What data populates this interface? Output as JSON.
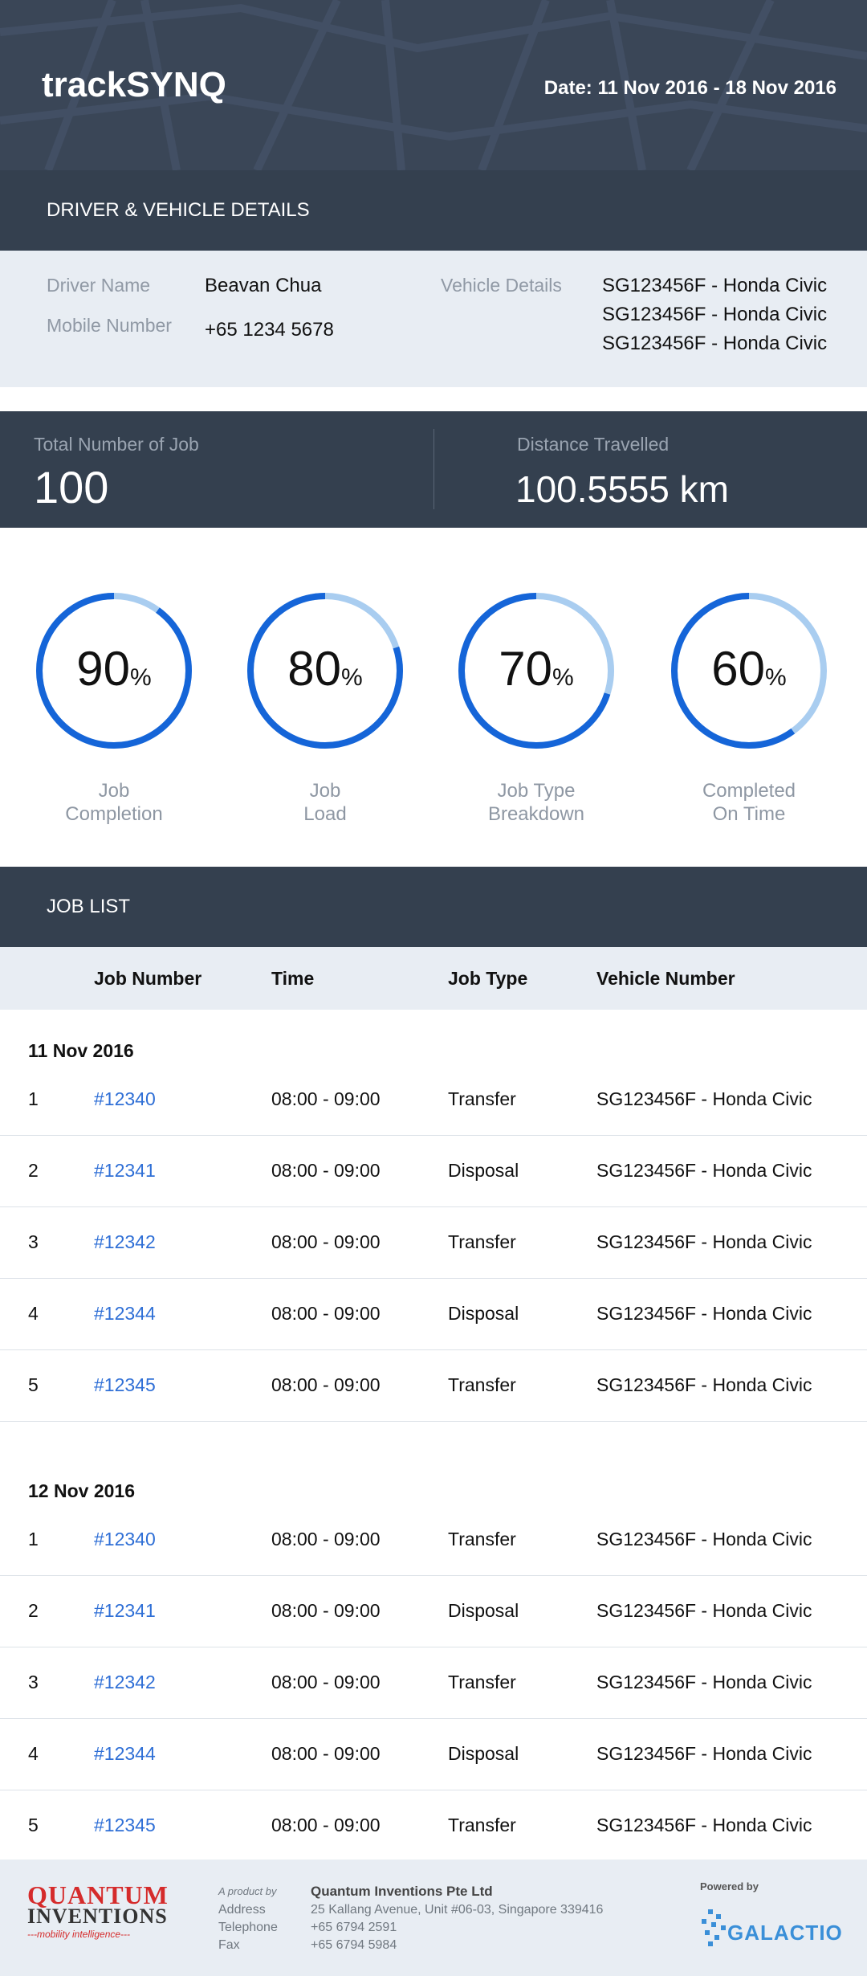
{
  "header": {
    "logo_text": "trackSYNQ",
    "date_label": "Date: 11 Nov 2016 - 18 Nov 2016"
  },
  "driver_section": {
    "title": "DRIVER & VEHICLE DETAILS",
    "driver_name_label": "Driver Name",
    "driver_name": "Beavan Chua",
    "mobile_label": "Mobile Number",
    "mobile": "+65 1234 5678",
    "vehicle_label": "Vehicle Details",
    "vehicles": [
      "SG123456F - Honda Civic",
      "SG123456F - Honda Civic",
      "SG123456F - Honda Civic"
    ]
  },
  "stats": {
    "total_jobs_label": "Total Number of Job",
    "total_jobs": "100",
    "distance_label": "Distance Travelled",
    "distance": "100.5555 km"
  },
  "gauges": [
    {
      "value": "90",
      "percent": 90,
      "unit": "%",
      "line1": "Job",
      "line2": "Completion"
    },
    {
      "value": "80",
      "percent": 80,
      "unit": "%",
      "line1": "Job",
      "line2": "Load"
    },
    {
      "value": "70",
      "percent": 70,
      "unit": "%",
      "line1": "Job Type",
      "line2": "Breakdown"
    },
    {
      "value": "60",
      "percent": 60,
      "unit": "%",
      "line1": "Completed",
      "line2": "On Time"
    }
  ],
  "colors": {
    "gauge_fill": "#1565d8",
    "gauge_track": "#a9cdf0",
    "header_bg": "#3a4657",
    "link": "#2f6fd6"
  },
  "job_list": {
    "title": "JOB LIST",
    "columns": [
      "Job Number",
      "Time",
      "Job Type",
      "Vehicle Number"
    ],
    "days": [
      {
        "date": "11 Nov 2016",
        "rows": [
          {
            "idx": "1",
            "job": "#12340",
            "time": "08:00 - 09:00",
            "type": "Transfer",
            "vehicle": "SG123456F - Honda Civic"
          },
          {
            "idx": "2",
            "job": "#12341",
            "time": "08:00 - 09:00",
            "type": "Disposal",
            "vehicle": "SG123456F - Honda Civic"
          },
          {
            "idx": "3",
            "job": "#12342",
            "time": "08:00 - 09:00",
            "type": "Transfer",
            "vehicle": "SG123456F - Honda Civic"
          },
          {
            "idx": "4",
            "job": "#12344",
            "time": "08:00 - 09:00",
            "type": "Disposal",
            "vehicle": "SG123456F - Honda Civic"
          },
          {
            "idx": "5",
            "job": "#12345",
            "time": "08:00 - 09:00",
            "type": "Transfer",
            "vehicle": "SG123456F - Honda Civic"
          }
        ]
      },
      {
        "date": "12 Nov 2016",
        "rows": [
          {
            "idx": "1",
            "job": "#12340",
            "time": "08:00 - 09:00",
            "type": "Transfer",
            "vehicle": "SG123456F - Honda Civic"
          },
          {
            "idx": "2",
            "job": "#12341",
            "time": "08:00 - 09:00",
            "type": "Disposal",
            "vehicle": "SG123456F - Honda Civic"
          },
          {
            "idx": "3",
            "job": "#12342",
            "time": "08:00 - 09:00",
            "type": "Transfer",
            "vehicle": "SG123456F - Honda Civic"
          },
          {
            "idx": "4",
            "job": "#12344",
            "time": "08:00 - 09:00",
            "type": "Disposal",
            "vehicle": "SG123456F - Honda Civic"
          },
          {
            "idx": "5",
            "job": "#12345",
            "time": "08:00 - 09:00",
            "type": "Transfer",
            "vehicle": "SG123456F - Honda Civic"
          }
        ]
      }
    ]
  },
  "footer": {
    "qi_logo_line1": "QUANTUM",
    "qi_logo_line2": "INVENTIONS",
    "qi_tagline": "---mobility intelligence---",
    "product_by": "A product by",
    "address_label": "Address",
    "telephone_label": "Telephone",
    "fax_label": "Fax",
    "company": "Quantum Inventions Pte Ltd",
    "address": "25 Kallang Avenue, Unit #06-03, Singapore 339416",
    "telephone": "+65 6794 2591",
    "fax": "+65 6794 5984",
    "powered_by": "Powered by",
    "galactio": "GALACTIO"
  }
}
